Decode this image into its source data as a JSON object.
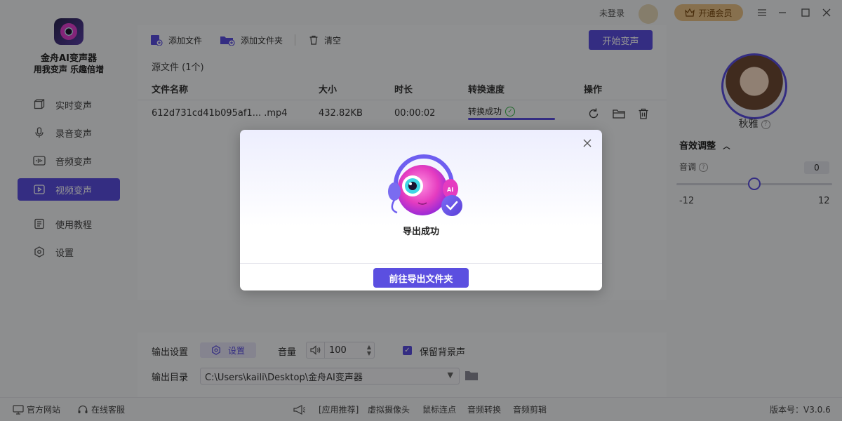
{
  "app": {
    "name": "金舟AI变声器",
    "slogan": "用我变声 乐趣倍增"
  },
  "sidebar": {
    "items": [
      {
        "label": "实时变声",
        "icon": "cube-icon",
        "active": false
      },
      {
        "label": "录音变声",
        "icon": "microphone-icon",
        "active": false
      },
      {
        "label": "音频变声",
        "icon": "audio-wave-icon",
        "active": false
      },
      {
        "label": "视频变声",
        "icon": "video-play-icon",
        "active": true
      },
      {
        "label": "使用教程",
        "icon": "book-icon",
        "active": false
      },
      {
        "label": "设置",
        "icon": "settings-icon",
        "active": false
      }
    ]
  },
  "header": {
    "login_text": "未登录",
    "vip_label": "开通会员"
  },
  "toolbar": {
    "add_file": "添加文件",
    "add_folder": "添加文件夹",
    "clear": "清空",
    "start": "开始变声"
  },
  "files": {
    "source_count": "源文件 (1个)",
    "columns": [
      "文件名称",
      "大小",
      "时长",
      "转换速度",
      "操作"
    ],
    "rows": [
      {
        "name": "612d731cd41b095af1... .mp4",
        "size": "432.82KB",
        "duration": "00:00:02",
        "status": "转换成功",
        "progress": 1.0
      }
    ]
  },
  "output": {
    "settings_label": "输出设置",
    "settings_button": "设置",
    "volume_label": "音量",
    "volume_value": "100",
    "keep_bg_label": "保留背景声",
    "keep_bg_checked": true,
    "dir_label": "输出目录",
    "dir_value": "C:\\Users\\kaili\\Desktop\\金舟AI变声器"
  },
  "voice_panel": {
    "voice_name": "秋雅",
    "fx_title": "音效调整",
    "pitch_label": "音调",
    "pitch_value": "0",
    "pitch_min": "-12",
    "pitch_max": "12",
    "pitch_fraction": 0.5
  },
  "footer": {
    "website": "官方网站",
    "support": "在线客服",
    "recommend": "[应用推荐]",
    "links": [
      "虚拟摄像头",
      "鼠标连点",
      "音频转换",
      "音频剪辑"
    ],
    "version": "版本号：V3.0.6"
  },
  "modal": {
    "message": "导出成功",
    "button": "前往导出文件夹"
  },
  "colors": {
    "accent": "#5b4fe0",
    "vip": "#e8c287",
    "success": "#39b54a"
  }
}
